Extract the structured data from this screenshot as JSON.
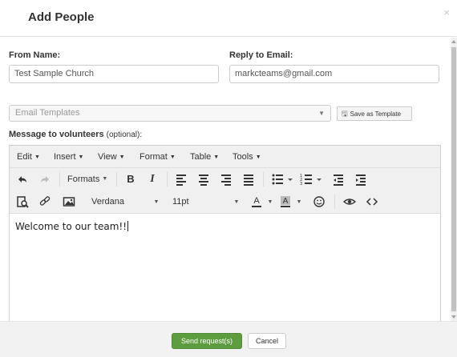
{
  "dialog": {
    "title": "Add People",
    "close_glyph": "×"
  },
  "form": {
    "from_name_label": "From Name:",
    "from_name_value": "Test Sample Church",
    "reply_email_label": "Reply to Email:",
    "reply_email_value": "markcteams@gmail.com",
    "template_select_value": "Email Templates",
    "save_template_label": "Save as Template",
    "message_label": "Message to volunteers",
    "message_optional": "(optional):"
  },
  "editor": {
    "menus": [
      "Edit",
      "Insert",
      "View",
      "Format",
      "Table",
      "Tools"
    ],
    "formats_label": "Formats",
    "font_family": "Verdana",
    "font_size": "11pt",
    "content": "Welcome to our team!!"
  },
  "footer": {
    "send_label": "Send request(s)",
    "cancel_label": "Cancel"
  },
  "colors": {
    "primary_button": "#5d9d3f",
    "footer_bg": "#f2f2f2"
  },
  "icons": [
    "undo-icon",
    "redo-icon",
    "bold-icon",
    "italic-icon",
    "align-left-icon",
    "align-center-icon",
    "align-right-icon",
    "align-justify-icon",
    "bullet-list-icon",
    "numbered-list-icon",
    "outdent-icon",
    "indent-icon",
    "find-replace-icon",
    "link-icon",
    "image-icon",
    "text-color-icon",
    "background-color-icon",
    "emoticon-icon",
    "preview-icon",
    "source-code-icon",
    "save-icon"
  ]
}
